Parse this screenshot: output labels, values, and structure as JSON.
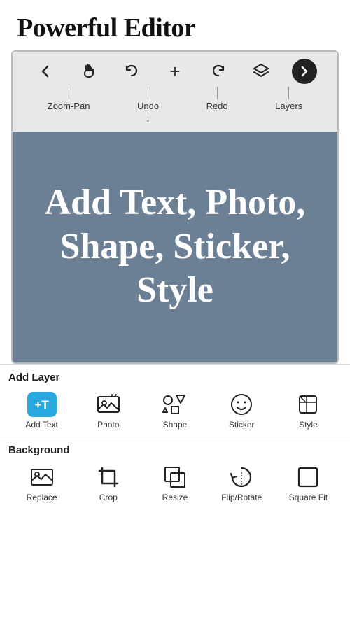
{
  "page": {
    "title": "Powerful Editor"
  },
  "toolbar": {
    "icons": [
      {
        "name": "back-icon",
        "symbol": "←",
        "interactable": true
      },
      {
        "name": "pan-icon",
        "symbol": "✋",
        "interactable": true
      },
      {
        "name": "undo-icon",
        "symbol": "↩",
        "interactable": true
      },
      {
        "name": "add-icon",
        "symbol": "+",
        "interactable": true
      },
      {
        "name": "redo-icon",
        "symbol": "↪",
        "interactable": true
      },
      {
        "name": "layers-icon",
        "symbol": "⧉",
        "interactable": true
      },
      {
        "name": "next-icon",
        "symbol": "→",
        "interactable": true
      }
    ],
    "labels": [
      {
        "name": "zoom-pan-label",
        "text": "Zoom-Pan",
        "hasLine": true,
        "lineLeft": true
      },
      {
        "name": "undo-label",
        "text": "Undo",
        "hasLine": true,
        "hasArrow": true
      },
      {
        "name": "redo-label",
        "text": "Redo",
        "hasLine": true
      },
      {
        "name": "layers-label",
        "text": "Layers",
        "hasLine": true
      }
    ]
  },
  "canvas": {
    "text": "Add Text, Photo, Shape, Sticker, Style",
    "bg_color": "#6b7f95"
  },
  "add_layer": {
    "section_label": "Add Layer",
    "items": [
      {
        "name": "add-text-item",
        "label": "Add Text",
        "icon_type": "add-text"
      },
      {
        "name": "photo-item",
        "label": "Photo",
        "icon_type": "photo"
      },
      {
        "name": "shape-item",
        "label": "Shape",
        "icon_type": "shape"
      },
      {
        "name": "sticker-item",
        "label": "Sticker",
        "icon_type": "sticker"
      },
      {
        "name": "style-item",
        "label": "Style",
        "icon_type": "style"
      }
    ]
  },
  "background": {
    "section_label": "Background",
    "items": [
      {
        "name": "replace-item",
        "label": "Replace",
        "icon_type": "replace"
      },
      {
        "name": "crop-item",
        "label": "Crop",
        "icon_type": "crop"
      },
      {
        "name": "resize-item",
        "label": "Resize",
        "icon_type": "resize"
      },
      {
        "name": "flip-rotate-item",
        "label": "Flip/Rotate",
        "icon_type": "flip-rotate"
      },
      {
        "name": "square-fit-item",
        "label": "Square Fit",
        "icon_type": "square-fit"
      }
    ]
  }
}
